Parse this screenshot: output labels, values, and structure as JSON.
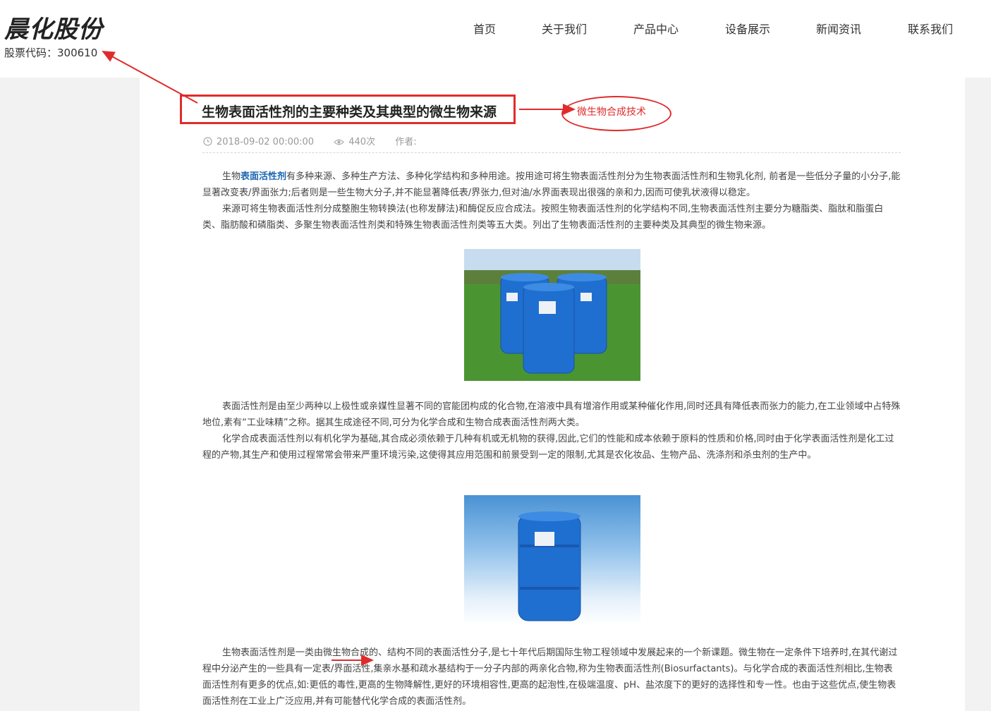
{
  "brand": {
    "logo_text": "晨化股份",
    "stock_code": "股票代码：300610"
  },
  "nav": {
    "items": [
      "首页",
      "关于我们",
      "产品中心",
      "设备展示",
      "新闻资讯",
      "联系我们"
    ]
  },
  "article": {
    "title": "生物表面活性剂的主要种类及其典型的微生物来源",
    "annotation": "微生物合成技术",
    "date": "2018-09-02 00:00:00",
    "views": "440次",
    "author_label": "作者:",
    "p1_before": "生物",
    "p1_keyword": "表面活性剂",
    "p1_after": "有多种来源、多种生产方法、多种化学结构和多种用途。按用途可将生物表面活性剂分为生物表面活性剂和生物乳化剂, 前者是一些低分子量的小分子,能显著改变表/界面张力;后者则是一些生物大分子,并不能显著降低表/界张力,但对油/水界面表现出很强的亲和力,因而可使乳状液得以稳定。",
    "p2": "来源可将生物表面活性剂分成整胞生物转换法(也称发酵法)和酶促反应合成法。按照生物表面活性剂的化学结构不同,生物表面活性剂主要分为糖脂类、脂肽和脂蛋白类、脂肪酸和磷脂类、多聚生物表面活性剂类和特殊生物表面活性剂类等五大类。列出了生物表面活性剂的主要种类及其典型的微生物来源。",
    "p3": "表面活性剂是由至少两种以上极性或亲媒性显著不同的官能团构成的化合物,在溶液中具有增溶作用或某种催化作用,同时还具有降低表而张力的能力,在工业领域中占特殊地位,素有“工业味精”之称。据其生成途径不同,可分为化学合成和生物合成表面活性剂两大类。",
    "p4": "化学合成表面活性剂以有机化学为基础,其合成必须依赖于几种有机或无机物的获得,因此,它们的性能和成本依赖于原料的性质和价格,同时由于化学表面活性剂是化工过程的产物,其生产和使用过程常常会带来严重环境污染,这使得其应用范围和前景受到一定的限制,尤其是农化妆品、生物产品、洗涤剂和杀虫剂的生产中。",
    "p5": "生物表面活性剂是一类由微生物合成的、结构不同的表面活性分子,是七十年代后期国际生物工程领域中发展起来的一个新课题。微生物在一定条件下培养时,在其代谢过程中分泌产生的一些具有一定表/界面活性,集亲水基和疏水基结构于一分子内部的两亲化合物,称为生物表面活性剂(Biosurfactants)。与化学合成的表面活性剂相比,生物表面活性剂有更多的优点,如:更低的毒性,更高的生物降解性,更好的环境相容性,更高的起泡性,在极端温度、pH、盐浓度下的更好的选择性和专一性。也由于这些优点,使生物表面活性剂在工业上广泛应用,并有可能替代化学合成的表面活性剂。"
  },
  "colors": {
    "annotation_red": "#e02b2b",
    "keyword_blue": "#1a66b3",
    "drum_blue": "#1f6fd1"
  }
}
